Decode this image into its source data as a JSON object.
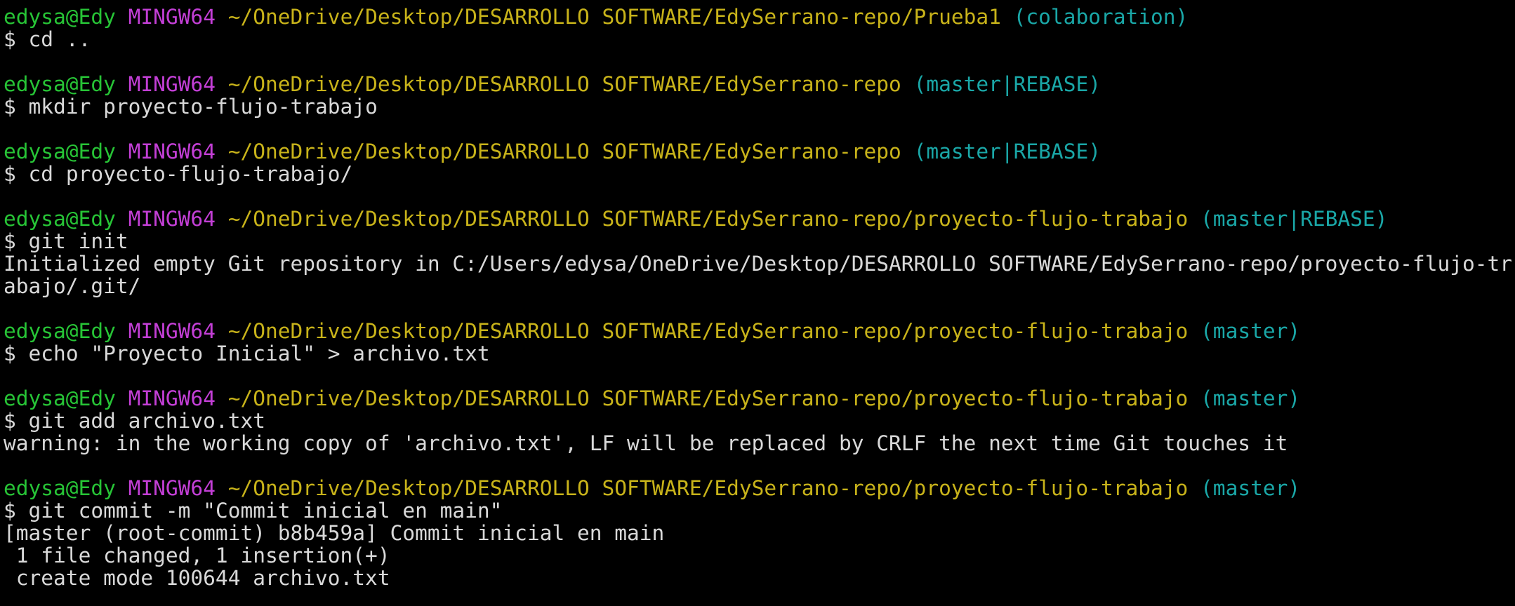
{
  "colors": {
    "background": "#000000",
    "user_host": "#27c436",
    "system": "#c33fd6",
    "path": "#c8b31a",
    "branch": "#1aa7a7",
    "text": "#d9d9d9"
  },
  "prompt": {
    "user_host": "edysa@Edy",
    "system": "MINGW64",
    "symbol": "$"
  },
  "blocks": [
    {
      "path": "~/OneDrive/Desktop/DESARROLLO SOFTWARE/EdySerrano-repo/Prueba1",
      "branch": "(colaboration)",
      "command": "cd ..",
      "output": []
    },
    {
      "path": "~/OneDrive/Desktop/DESARROLLO SOFTWARE/EdySerrano-repo",
      "branch": "(master|REBASE)",
      "command": "mkdir proyecto-flujo-trabajo",
      "output": []
    },
    {
      "path": "~/OneDrive/Desktop/DESARROLLO SOFTWARE/EdySerrano-repo",
      "branch": "(master|REBASE)",
      "command": "cd proyecto-flujo-trabajo/",
      "output": []
    },
    {
      "path": "~/OneDrive/Desktop/DESARROLLO SOFTWARE/EdySerrano-repo/proyecto-flujo-trabajo",
      "branch": "(master|REBASE)",
      "command": "git init",
      "output": [
        "Initialized empty Git repository in C:/Users/edysa/OneDrive/Desktop/DESARROLLO SOFTWARE/EdySerrano-repo/proyecto-flujo-tr",
        "abajo/.git/"
      ]
    },
    {
      "path": "~/OneDrive/Desktop/DESARROLLO SOFTWARE/EdySerrano-repo/proyecto-flujo-trabajo",
      "branch": "(master)",
      "command": "echo \"Proyecto Inicial\" > archivo.txt",
      "output": []
    },
    {
      "path": "~/OneDrive/Desktop/DESARROLLO SOFTWARE/EdySerrano-repo/proyecto-flujo-trabajo",
      "branch": "(master)",
      "command": "git add archivo.txt",
      "output": [
        "warning: in the working copy of 'archivo.txt', LF will be replaced by CRLF the next time Git touches it"
      ]
    },
    {
      "path": "~/OneDrive/Desktop/DESARROLLO SOFTWARE/EdySerrano-repo/proyecto-flujo-trabajo",
      "branch": "(master)",
      "command": "git commit -m \"Commit inicial en main\"",
      "output": [
        "[master (root-commit) b8b459a] Commit inicial en main",
        " 1 file changed, 1 insertion(+)",
        " create mode 100644 archivo.txt"
      ]
    }
  ]
}
